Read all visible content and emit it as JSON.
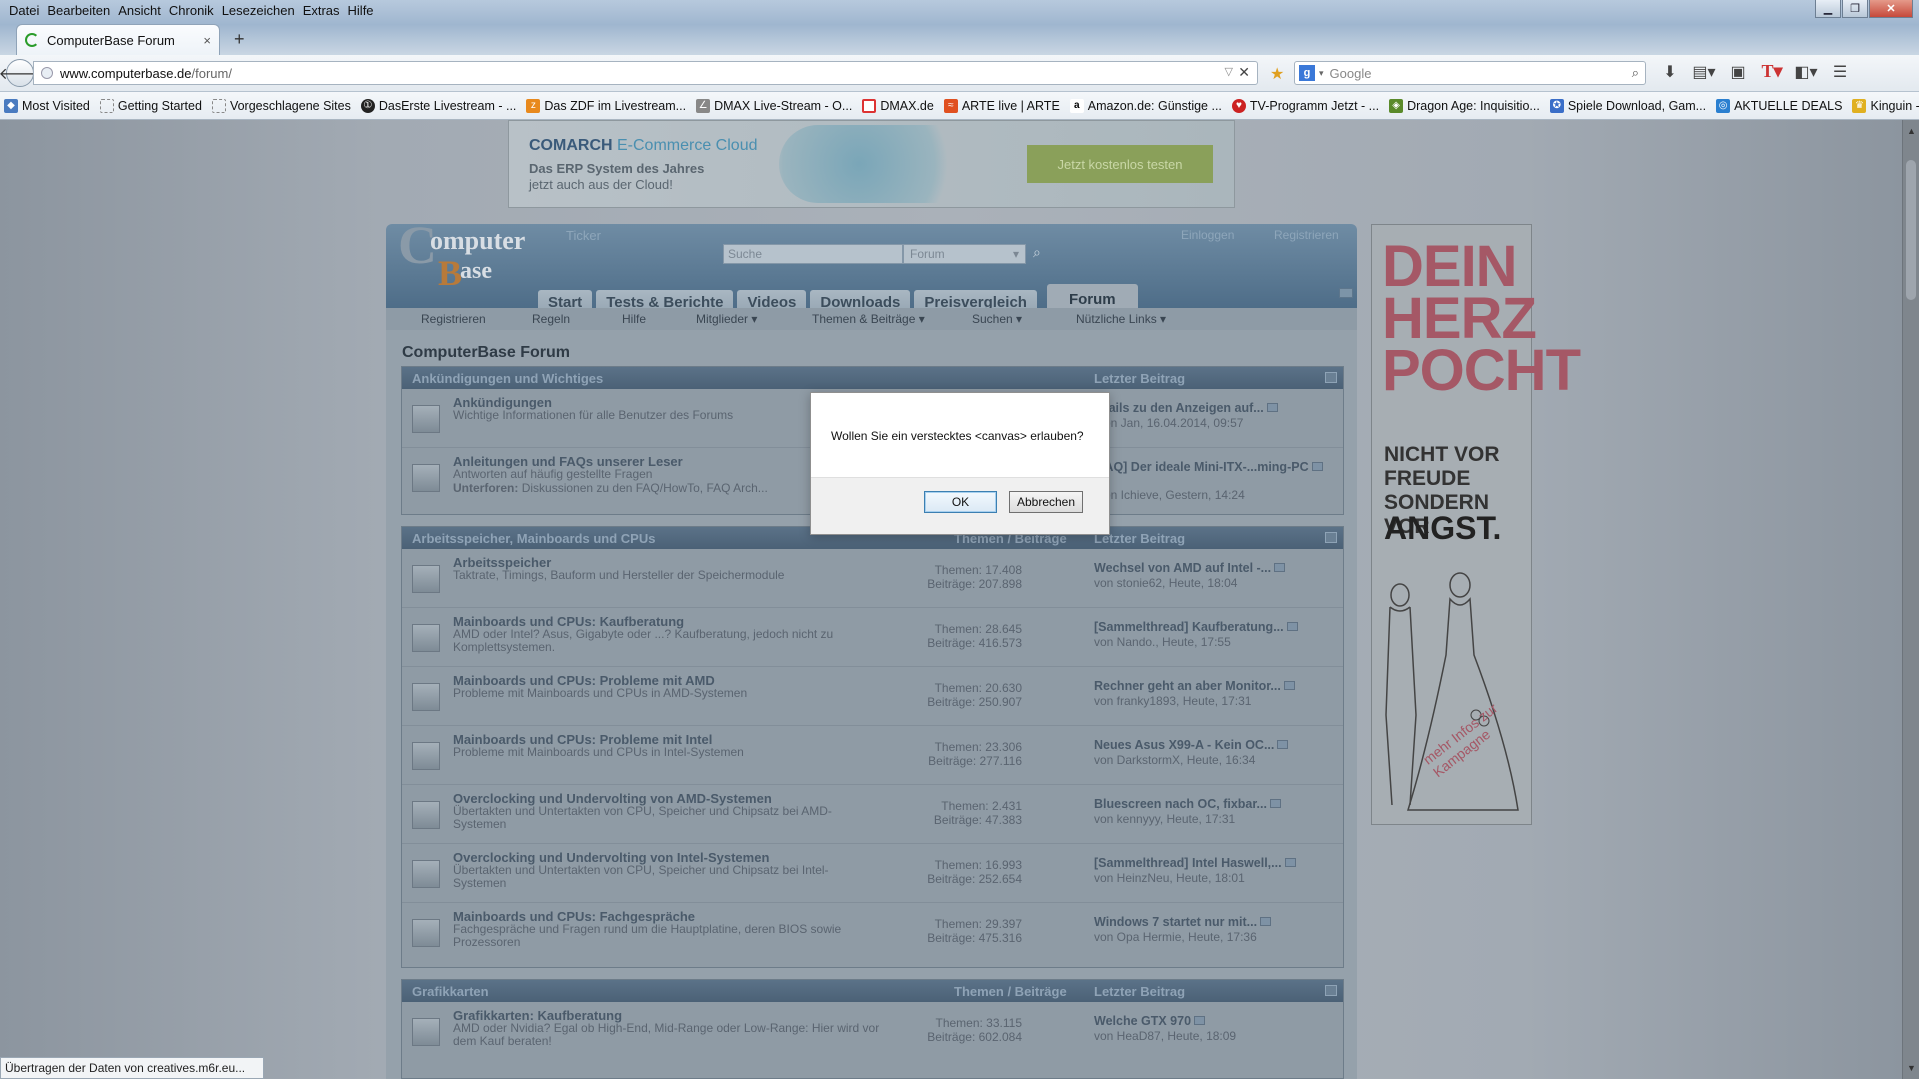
{
  "menubar": [
    "Datei",
    "Bearbeiten",
    "Ansicht",
    "Chronik",
    "Lesezeichen",
    "Extras",
    "Hilfe"
  ],
  "tab": {
    "title": "ComputerBase Forum",
    "close": "×",
    "new_tab": "+"
  },
  "url": {
    "domain": "www.computerbase.de",
    "path": "/forum/"
  },
  "search": {
    "engine": "g",
    "placeholder": "Google"
  },
  "bookmarks": [
    "Most Visited",
    "Getting Started",
    "Vorgeschlagene Sites",
    "DasErste Livestream - ...",
    "Das ZDF im Livestream...",
    "DMAX Live-Stream - O...",
    "DMAX.de",
    "ARTE live | ARTE",
    "Amazon.de: Günstige ...",
    "TV-Programm Jetzt - ...",
    "Dragon Age: Inquisitio...",
    "Spiele Download, Gam...",
    "AKTUELLE DEALS",
    "Kinguin - Compare & ..."
  ],
  "ad_banner": {
    "brand": "COMARCH",
    "brand_rest": "E-Commerce Cloud",
    "line1": "Das ERP System des Jahres",
    "line2": "jetzt auch aus der Cloud!",
    "button": "Jetzt kostenlos testen"
  },
  "forum_header": {
    "ticker": "Ticker",
    "search_placeholder": "Suche",
    "scope": "Forum",
    "login": "Einloggen",
    "register": "Registrieren"
  },
  "tabs": [
    "Start",
    "Tests & Berichte",
    "Videos",
    "Downloads",
    "Preisvergleich",
    "Forum"
  ],
  "subnav": [
    "Registrieren",
    "Regeln",
    "Hilfe",
    "Mitglieder ▾",
    "Themen & Beiträge ▾",
    "Suchen ▾",
    "Nützliche Links ▾"
  ],
  "page_title": "ComputerBase Forum",
  "categories": [
    {
      "name": "Ankündigungen und Wichtiges",
      "col_stats": "",
      "col_last": "Letzter Beitrag",
      "rows": [
        {
          "name": "Ankündigungen",
          "desc": "Wichtige Informationen für alle Benutzer des Forums",
          "stats1": "",
          "stats2": "",
          "last": "...tails zu den Anzeigen auf...",
          "by": "...on Jan, 16.04.2014, 09:57"
        },
        {
          "name": "Anleitungen und FAQs unserer Leser",
          "desc": "Antworten auf häufig gestellte Fragen",
          "sub": "Unterforen:",
          "sub_items": "Diskussionen zu den FAQ/HowTo,  FAQ Arch...",
          "stats1": "",
          "stats2": "",
          "last": "...AQ] Der ideale Mini-ITX-...ming-PC",
          "by": "...on Ichieve, Gestern, 14:24"
        }
      ]
    },
    {
      "name": "Arbeitsspeicher, Mainboards und CPUs",
      "col_stats": "Themen / Beiträge",
      "col_last": "Letzter Beitrag",
      "rows": [
        {
          "name": "Arbeitsspeicher",
          "desc": "Taktrate, Timings, Bauform und Hersteller der Speichermodule",
          "stats1": "Themen: 17.408",
          "stats2": "Beiträge: 207.898",
          "last": "Wechsel von AMD auf Intel -...",
          "by": "von stonie62, Heute, 18:04"
        },
        {
          "name": "Mainboards und CPUs: Kaufberatung",
          "desc": "AMD oder Intel? Asus, Gigabyte oder ...? Kaufberatung, jedoch nicht zu Komplettsystemen.",
          "stats1": "Themen: 28.645",
          "stats2": "Beiträge: 416.573",
          "last": "[Sammelthread] Kaufberatung...",
          "by": "von Nando., Heute, 17:55"
        },
        {
          "name": "Mainboards und CPUs: Probleme mit AMD",
          "desc": "Probleme mit Mainboards und CPUs in AMD-Systemen",
          "stats1": "Themen: 20.630",
          "stats2": "Beiträge: 250.907",
          "last": "Rechner geht an aber Monitor...",
          "by": "von franky1893, Heute, 17:31"
        },
        {
          "name": "Mainboards und CPUs: Probleme mit Intel",
          "desc": "Probleme mit Mainboards und CPUs in Intel-Systemen",
          "stats1": "Themen: 23.306",
          "stats2": "Beiträge: 277.116",
          "last": "Neues Asus X99-A - Kein OC...",
          "by": "von DarkstormX, Heute, 16:34"
        },
        {
          "name": "Overclocking und Undervolting von AMD-Systemen",
          "desc": "Übertakten und Untertakten von CPU, Speicher und Chipsatz bei AMD-Systemen",
          "stats1": "Themen: 2.431",
          "stats2": "Beiträge: 47.383",
          "last": "Bluescreen nach OC, fixbar...",
          "by": "von kennyyy, Heute, 17:31"
        },
        {
          "name": "Overclocking und Undervolting von Intel-Systemen",
          "desc": "Übertakten und Untertakten von CPU, Speicher und Chipsatz bei Intel-Systemen",
          "stats1": "Themen: 16.993",
          "stats2": "Beiträge: 252.654",
          "last": "[Sammelthread] Intel Haswell,...",
          "by": "von HeinzNeu, Heute, 18:01"
        },
        {
          "name": "Mainboards und CPUs: Fachgespräche",
          "desc": "Fachgespräche und Fragen rund um die Hauptplatine, deren BIOS sowie Prozessoren",
          "stats1": "Themen: 29.397",
          "stats2": "Beiträge: 475.316",
          "last": "Windows 7 startet nur mit...",
          "by": "von Opa Hermie, Heute, 17:36"
        }
      ]
    },
    {
      "name": "Grafikkarten",
      "col_stats": "Themen / Beiträge",
      "col_last": "Letzter Beitrag",
      "rows": [
        {
          "name": "Grafikkarten: Kaufberatung",
          "desc": "AMD oder Nvidia? Egal ob High-End, Mid-Range oder Low-Range: Hier wird vor dem Kauf beraten!",
          "stats1": "Themen: 33.115",
          "stats2": "Beiträge: 602.084",
          "last": "Welche GTX 970",
          "by": "von HeaD87, Heute, 18:09"
        }
      ]
    }
  ],
  "side_ad": {
    "line1": "DEIN",
    "line2": "HERZ",
    "line3": "POCHT",
    "line4": "NICHT VOR",
    "line5": "FREUDE",
    "line6": "SONDERN VOR",
    "line7": "ANGST.",
    "more": "mehr Infos zur Kampagne"
  },
  "dialog": {
    "message": "Wollen Sie ein verstecktes <canvas> erlauben?",
    "ok": "OK",
    "cancel": "Abbrechen"
  },
  "status": "Übertragen der Daten von creatives.m6r.eu..."
}
